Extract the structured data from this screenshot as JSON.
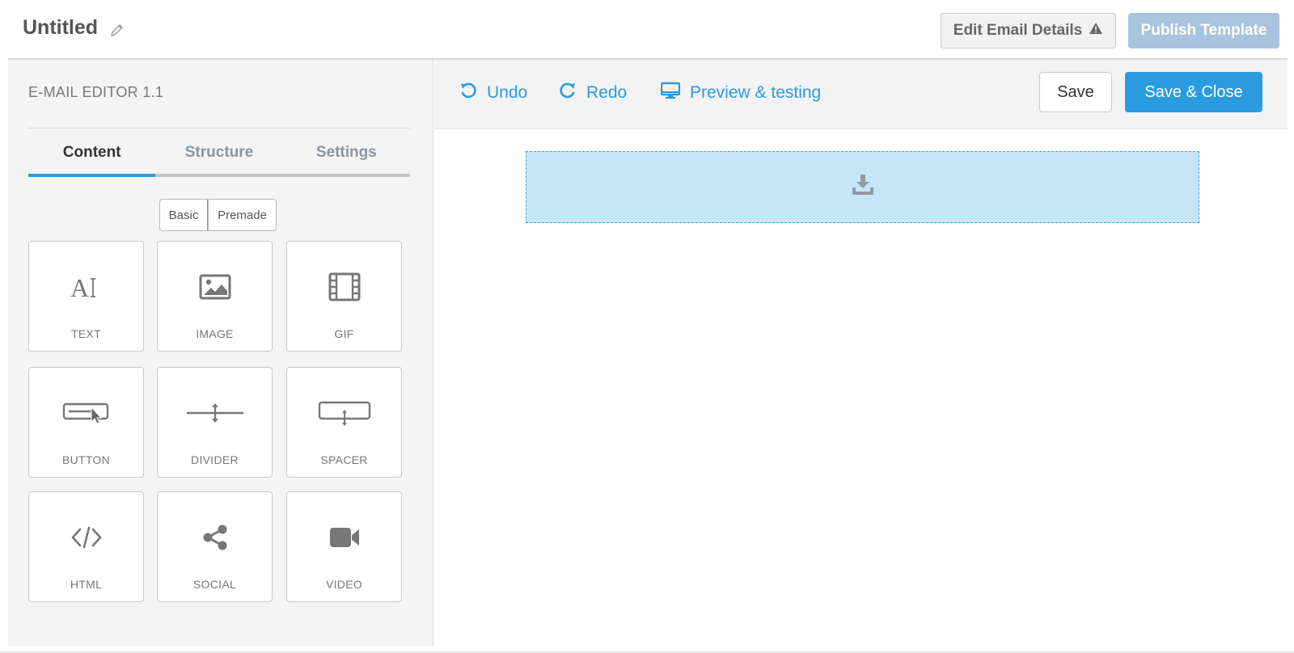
{
  "header": {
    "title": "Untitled",
    "edit_details_label": "Edit Email Details",
    "publish_label": "Publish Template"
  },
  "sidebar": {
    "version": "E-MAIL EDITOR 1.1",
    "tabs": [
      {
        "label": "Content",
        "active": true
      },
      {
        "label": "Structure",
        "active": false
      },
      {
        "label": "Settings",
        "active": false
      }
    ],
    "segment": {
      "basic": "Basic",
      "premade": "Premade",
      "selected": "Basic"
    },
    "blocks": [
      {
        "label": "TEXT",
        "icon": "text-icon"
      },
      {
        "label": "IMAGE",
        "icon": "image-icon"
      },
      {
        "label": "GIF",
        "icon": "film-icon"
      },
      {
        "label": "BUTTON",
        "icon": "button-icon"
      },
      {
        "label": "DIVIDER",
        "icon": "divider-icon"
      },
      {
        "label": "SPACER",
        "icon": "spacer-icon"
      },
      {
        "label": "HTML",
        "icon": "code-icon"
      },
      {
        "label": "SOCIAL",
        "icon": "share-icon"
      },
      {
        "label": "VIDEO",
        "icon": "video-icon"
      }
    ]
  },
  "toolbar": {
    "undo_label": "Undo",
    "redo_label": "Redo",
    "preview_label": "Preview & testing",
    "save_label": "Save",
    "save_close_label": "Save & Close"
  },
  "colors": {
    "accent": "#2b9be0",
    "publish_disabled": "#a9c4de",
    "dropzone": "#c6e6f6",
    "sidebar_bg": "#f4f4f4"
  }
}
